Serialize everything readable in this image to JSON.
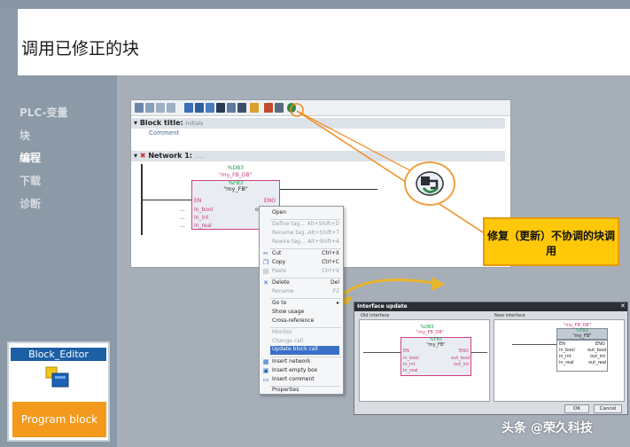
{
  "slide": {
    "title": "调用已修正的块"
  },
  "nav": {
    "items": [
      "PLC-变量",
      "块",
      "编程",
      "下载",
      "诊断"
    ],
    "active_index": 2
  },
  "block_editor": {
    "header": "Block_Editor",
    "button": "Program block"
  },
  "editor": {
    "block_title_label": "Block title:",
    "block_title_value": "Initials",
    "comment": "Comment",
    "network_label": "Network 1:",
    "network_value": "......",
    "db_number": "%DB3",
    "db_name": "\"my_FB_DB\"",
    "fb_number": "%FB3",
    "fb_name": "\"my_FB\"",
    "pins_left": [
      "EN",
      "in_bool",
      "in_int",
      "in_real"
    ],
    "pins_right": [
      "ENO"
    ],
    "pin_out_partial": "ou",
    "dots": "..."
  },
  "context_menu": {
    "items": [
      {
        "label": "Open",
        "key": "",
        "disabled": false,
        "icon": ""
      },
      {
        "label": "Define tag...",
        "key": "Alt+Shift+D",
        "disabled": true,
        "icon": ""
      },
      {
        "label": "Rename tag...",
        "key": "Alt+Shift+T",
        "disabled": true,
        "icon": ""
      },
      {
        "label": "Rewire tag...",
        "key": "Alt+Shift+A",
        "disabled": true,
        "icon": ""
      },
      {
        "label": "Cut",
        "key": "Ctrl+X",
        "disabled": false,
        "icon": "cut"
      },
      {
        "label": "Copy",
        "key": "Ctrl+C",
        "disabled": false,
        "icon": "copy"
      },
      {
        "label": "Paste",
        "key": "Ctrl+V",
        "disabled": true,
        "icon": "paste"
      },
      {
        "label": "Delete",
        "key": "Del",
        "disabled": false,
        "icon": "delete"
      },
      {
        "label": "Rename",
        "key": "F2",
        "disabled": true,
        "icon": ""
      },
      {
        "label": "Go to",
        "key": "",
        "disabled": false,
        "icon": ""
      },
      {
        "label": "Show usage",
        "key": "",
        "disabled": false,
        "icon": ""
      },
      {
        "label": "Cross-reference",
        "key": "",
        "disabled": false,
        "icon": ""
      },
      {
        "label": "Monitor",
        "key": "",
        "disabled": true,
        "icon": ""
      },
      {
        "label": "Change call",
        "key": "",
        "disabled": true,
        "icon": ""
      },
      {
        "label": "Update block call",
        "key": "",
        "disabled": false,
        "icon": "",
        "highlighted": true
      },
      {
        "label": "Insert network",
        "key": "",
        "disabled": false,
        "icon": "network"
      },
      {
        "label": "Insert empty box",
        "key": "",
        "disabled": false,
        "icon": "box"
      },
      {
        "label": "Insert comment",
        "key": "",
        "disabled": false,
        "icon": "comment"
      },
      {
        "label": "Properties",
        "key": "",
        "disabled": false,
        "icon": ""
      }
    ]
  },
  "callout": {
    "text": "修复（更新）不协调的块调用"
  },
  "dialog": {
    "title": "Interface update",
    "old_label": "Old interface",
    "new_label": "New interface",
    "old": {
      "db_number": "%DB3",
      "db_name": "\"my_FB_DB\"",
      "fb_number": "%FB3",
      "fb_name": "\"my_FB\"",
      "pins_left": [
        "EN",
        "in_bool",
        "in_int",
        "in_real"
      ],
      "pins_right": [
        "ENO",
        "out_bool",
        "out_int"
      ]
    },
    "new": {
      "db_name": "\"my_FB_DB\"",
      "fb_number": "%FB3",
      "fb_name": "\"my_FB\"",
      "pins_left": [
        "EN",
        "in_bool",
        "in_int",
        "in_real"
      ],
      "pins_right": [
        "ENO",
        "out_bool",
        "out_int",
        "out_real"
      ]
    },
    "ok": "OK",
    "cancel": "Cancel"
  },
  "watermark": "头条 @荣久科技",
  "colors": {
    "accent_orange": "#f39a1c",
    "callout_yellow": "#ffc90a",
    "pin_pink": "#d23e86",
    "db_green": "#1d9c4a",
    "highlight_blue": "#3a70c8"
  }
}
